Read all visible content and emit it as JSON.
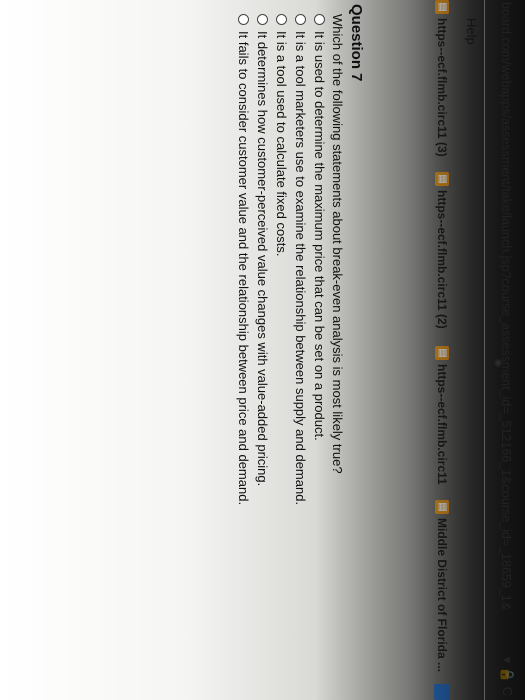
{
  "browser": {
    "url": "board.com/webapps/assessment/take/launch.jsp?course_assessment_id=_512166_1&course_id=_18659_1&",
    "url_tail": "▾ 🔒 C"
  },
  "menu": {
    "help_label": "Help"
  },
  "bookmarks": [
    {
      "label": "https--ecf.flmb.circ11 (3)",
      "icon": "page-icon"
    },
    {
      "label": "https--ecf.flmb.circ11 (2)",
      "icon": "page-icon"
    },
    {
      "label": "https--ecf.flmb.circ11",
      "icon": "page-icon"
    },
    {
      "label": "Middle District of Florida ...",
      "icon": "page-icon"
    }
  ],
  "question": {
    "title": "Question 7",
    "text": "Which of the following statements about break-even analysis is most likely true?",
    "options": [
      "It is used to determine the maximum price that can be set on a product.",
      "It is a tool marketers use to examine the relationship between supply and demand.",
      "It is a tool used to calculate fixed costs.",
      "It determines how customer-perceived value changes with value-added pricing.",
      "It fails to consider customer value and the relationship between price and demand."
    ]
  }
}
